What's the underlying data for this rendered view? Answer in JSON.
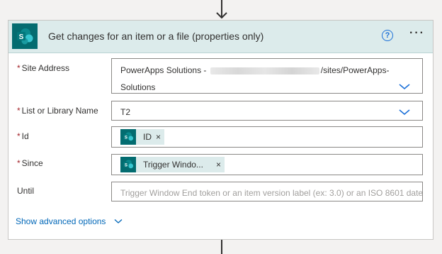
{
  "action": {
    "title": "Get changes for an item or a file (properties only)",
    "icons": {
      "connector": "sharepoint-icon",
      "help": "help-icon",
      "more": "more-options-icon"
    },
    "help_glyph": "?",
    "more_glyph": "···"
  },
  "fields": {
    "site_address": {
      "label": "Site Address",
      "required_mark": "*",
      "value_line1_prefix": "PowerApps Solutions - ",
      "value_line1_suffix": "/sites/PowerApps-",
      "value_line2": "Solutions"
    },
    "list_or_library": {
      "label": "List or Library Name",
      "required_mark": "*",
      "value": "T2"
    },
    "id": {
      "label": "Id",
      "required_mark": "*",
      "token_label": "ID",
      "token_remove": "×"
    },
    "since": {
      "label": "Since",
      "required_mark": "*",
      "token_label": "Trigger Windo...",
      "token_remove": "×"
    },
    "until": {
      "label": "Until",
      "placeholder": "Trigger Window End token or an item version label (ex: 3.0) or an ISO 8601 date"
    }
  },
  "advanced": {
    "label": "Show advanced options"
  },
  "colors": {
    "sharepoint": "#036c70",
    "header_bg": "#dcebeb",
    "link": "#0067b8",
    "required": "#a4262c",
    "chevron": "#1a6fd8"
  }
}
